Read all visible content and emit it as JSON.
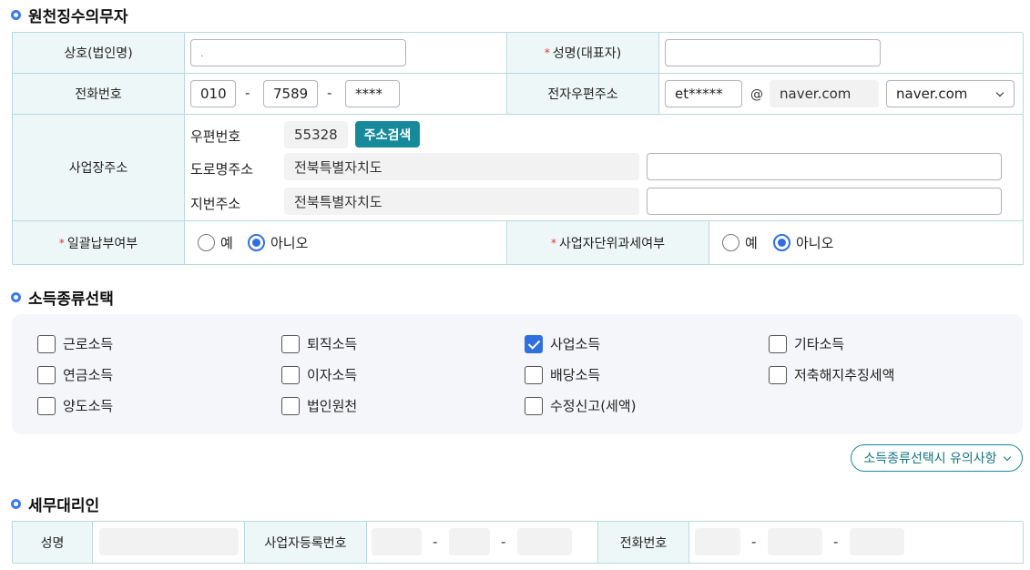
{
  "withholding": {
    "title": "원천징수의무자",
    "company_label": "상호(법인명)",
    "company_value": ".",
    "rep_label": "성명(대표자)",
    "rep_value": "",
    "phone_label": "전화번호",
    "phone1": "010",
    "phone2": "7589",
    "phone3": "****",
    "email_label": "전자우편주소",
    "email_id": "et*****",
    "email_at": "@",
    "email_domain": "naver.com",
    "email_select": "naver.com",
    "address_label": "사업장주소",
    "zip_label": "우편번호",
    "zip_value": "55328",
    "address_search_btn": "주소검색",
    "road_label": "도로명주소",
    "road_value": "전북특별자치도",
    "road_detail": "",
    "lot_label": "지번주소",
    "lot_value": "전북특별자치도",
    "lot_detail": "",
    "lump_label": "일괄납부여부",
    "unit_label": "사업자단위과세여부",
    "yes": "예",
    "no": "아니오",
    "lump_selected": "아니오",
    "unit_selected": "아니오"
  },
  "income": {
    "title": "소득종류선택",
    "items": [
      {
        "label": "근로소득",
        "checked": false
      },
      {
        "label": "퇴직소득",
        "checked": false
      },
      {
        "label": "사업소득",
        "checked": true
      },
      {
        "label": "기타소득",
        "checked": false
      },
      {
        "label": "연금소득",
        "checked": false
      },
      {
        "label": "이자소득",
        "checked": false
      },
      {
        "label": "배당소득",
        "checked": false
      },
      {
        "label": "저축해지추징세액",
        "checked": false
      },
      {
        "label": "양도소득",
        "checked": false
      },
      {
        "label": "법인원천",
        "checked": false
      },
      {
        "label": "수정신고(세액)",
        "checked": false
      }
    ],
    "notice_btn": "소득종류선택시 유의사항"
  },
  "agent": {
    "title": "세무대리인",
    "name_label": "성명",
    "biz_label": "사업자등록번호",
    "phone_label": "전화번호"
  },
  "colors": {
    "accent": "#2f6fdf",
    "teal": "#168a9a",
    "label_bg": "#eef7f7",
    "border": "#b9d9de"
  }
}
